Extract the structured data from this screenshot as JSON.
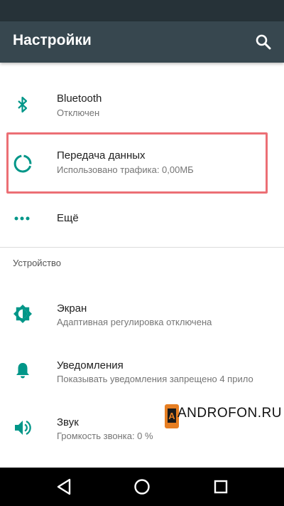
{
  "app_bar": {
    "title": "Настройки",
    "search_icon": "search-icon"
  },
  "colors": {
    "accent": "#009688",
    "app_bar": "#37474f",
    "status_bar": "#263238",
    "highlight": "#ec6f75"
  },
  "items": {
    "bluetooth": {
      "title": "Bluetooth",
      "subtitle": "Отключен",
      "icon": "bluetooth-icon"
    },
    "data": {
      "title": "Передача данных",
      "subtitle": "Использовано трафика: 0,00МБ",
      "icon": "data-usage-icon"
    },
    "more": {
      "title": "Ещё",
      "icon": "more-dots-icon"
    },
    "screen": {
      "title": "Экран",
      "subtitle": "Адаптивная регулировка отключена",
      "icon": "brightness-icon"
    },
    "notifications": {
      "title": "Уведомления",
      "subtitle": "Показывать уведомления запрещено 4 прило",
      "icon": "bell-icon"
    },
    "sound": {
      "title": "Звук",
      "subtitle": "Громкость звонка: 0 %",
      "icon": "volume-icon"
    }
  },
  "sections": {
    "device": "Устройство"
  },
  "watermark": {
    "text": "ANDROFON.RU"
  },
  "nav": {
    "back_icon": "back-triangle-icon",
    "home_icon": "home-circle-icon",
    "recents_icon": "recents-square-icon"
  }
}
